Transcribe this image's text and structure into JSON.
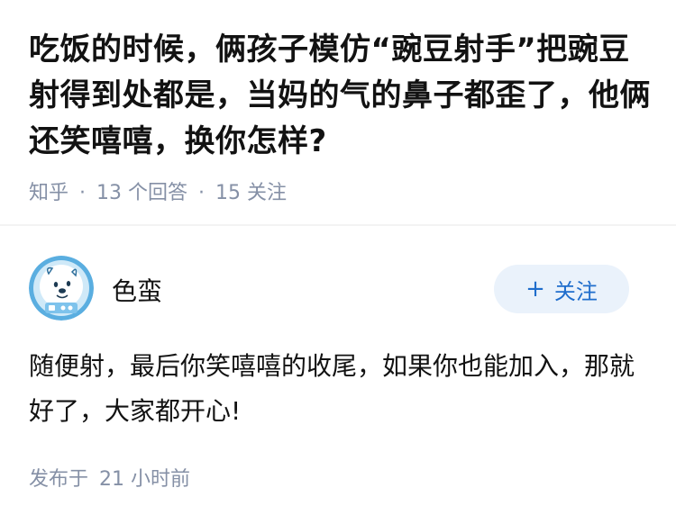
{
  "question": {
    "title": "吃饭的时候，俩孩子模仿“豌豆射手”把豌豆射得到处都是，当妈的气的鼻子都歪了，他俩还笑嘻嘻，换你怎样?",
    "source": "知乎",
    "separator": "·",
    "answer_count": "13",
    "answer_count_label": "个回答",
    "follower_count": "15",
    "follower_count_label": "关注"
  },
  "answer": {
    "author": {
      "name": "色蛮",
      "avatar_icon": "astronaut-dog-avatar",
      "follow_button": {
        "icon": "+",
        "label": "关注"
      }
    },
    "content": "随便射，最后你笑嘻嘻的收尾，如果你也能加入，那就好了，大家都开心!",
    "published_label": "发布于",
    "published_time": "21 小时前"
  },
  "colors": {
    "title": "#121212",
    "meta": "#8590a6",
    "follow_bg": "#eaf2fb",
    "follow_text": "#1f6dcc",
    "divider": "#f3f3f3"
  }
}
